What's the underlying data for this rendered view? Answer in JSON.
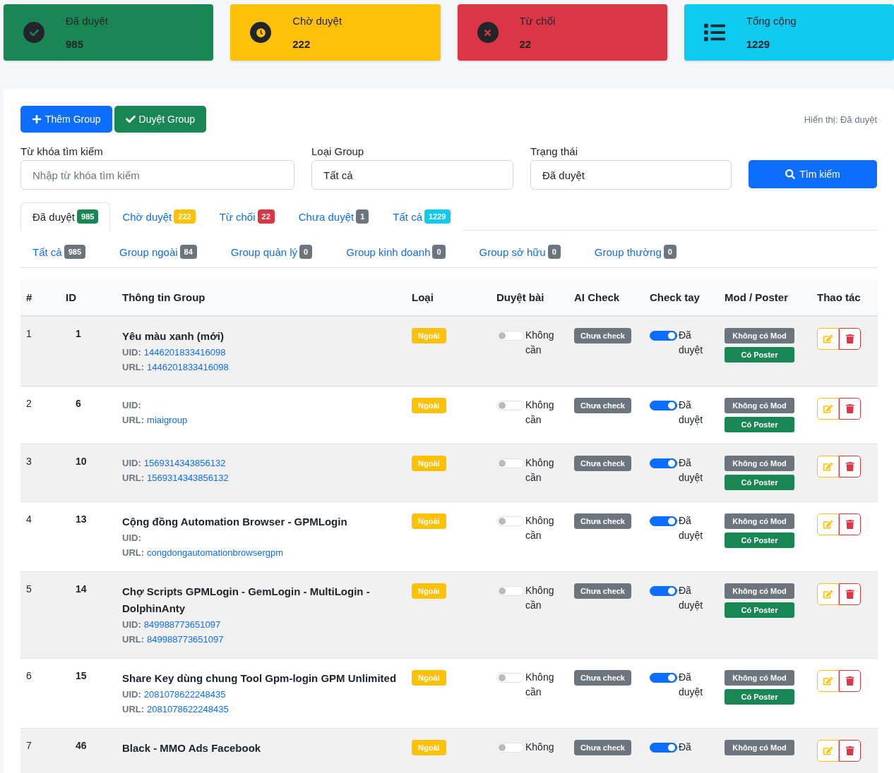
{
  "stats": [
    {
      "label": "Đã duyệt",
      "value": "985",
      "kind": "approved"
    },
    {
      "label": "Chờ duyệt",
      "value": "222",
      "kind": "pending"
    },
    {
      "label": "Từ chối",
      "value": "22",
      "kind": "rejected"
    },
    {
      "label": "Tổng cộng",
      "value": "1229",
      "kind": "total"
    }
  ],
  "actions": [
    {
      "label": "Thêm Group",
      "kind": "add"
    },
    {
      "label": "Duyệt Group",
      "kind": "approve"
    }
  ],
  "display_note": "Hiển thị: Đã duyệt",
  "filters": {
    "keyword": {
      "label": "Từ khóa tìm kiếm",
      "placeholder": "Nhập từ khóa tìm kiếm"
    },
    "type": {
      "label": "Loại Group",
      "value": "Tất cả"
    },
    "status": {
      "label": "Trạng thái",
      "value": "Đã duyệt"
    },
    "search_button": "Tìm kiếm"
  },
  "status_tabs": [
    {
      "label": "Đã duyệt",
      "count": "985",
      "color": "#198754",
      "selected": true
    },
    {
      "label": "Chờ duyệt",
      "count": "222",
      "color": "#ffc107",
      "selected": false
    },
    {
      "label": "Từ chối",
      "count": "22",
      "color": "#dc3545",
      "selected": false
    },
    {
      "label": "Chưa duyệt",
      "count": "1",
      "color": "#6c757d",
      "selected": false
    },
    {
      "label": "Tất cả",
      "count": "1229",
      "color": "#0dcaf0",
      "selected": false
    }
  ],
  "type_tabs": [
    {
      "label": "Tất cả",
      "count": "985"
    },
    {
      "label": "Group ngoài",
      "count": "84"
    },
    {
      "label": "Group quản lý",
      "count": "0"
    },
    {
      "label": "Group kinh doanh",
      "count": "0"
    },
    {
      "label": "Group sở hữu",
      "count": "0"
    },
    {
      "label": "Group thường",
      "count": "0"
    }
  ],
  "table": {
    "columns": [
      "#",
      "ID",
      "Thông tin Group",
      "Loại",
      "Duyệt bài",
      "AI Check",
      "Check tay",
      "Mod / Poster",
      "Thao tác"
    ],
    "rows": [
      {
        "index": "1",
        "id": "1",
        "name": "Yêu màu xanh (mới)",
        "uid_label": "UID:",
        "uid": "1446201833416098",
        "url_label": "URL:",
        "url": "1446201833416098",
        "type": "Ngoài",
        "post_review": {
          "on": false,
          "label": "Không cần"
        },
        "ai_check": "Chưa check",
        "manual_check": {
          "on": true,
          "label": "Đã duyệt"
        },
        "mod": "Không có Mod",
        "poster": "Có Poster"
      },
      {
        "index": "2",
        "id": "6",
        "uid_label": "UID:",
        "url_label": "URL:",
        "url": "miaigroup",
        "type": "Ngoài",
        "post_review": {
          "on": false,
          "label": "Không cần"
        },
        "ai_check": "Chưa check",
        "manual_check": {
          "on": true,
          "label": "Đã duyệt"
        },
        "mod": "Không có Mod",
        "poster": "Có Poster"
      },
      {
        "index": "3",
        "id": "10",
        "uid_label": "UID:",
        "uid": "1569314343856132",
        "url_label": "URL:",
        "url": "1569314343856132",
        "type": "Ngoài",
        "post_review": {
          "on": false,
          "label": "Không cần"
        },
        "ai_check": "Chưa check",
        "manual_check": {
          "on": true,
          "label": "Đã duyệt"
        },
        "mod": "Không có Mod",
        "poster": "Có Poster"
      },
      {
        "index": "4",
        "id": "13",
        "name": "Cộng đồng Automation Browser - GPMLogin",
        "uid_label": "UID:",
        "url_label": "URL:",
        "url": "congdongautomationbrowsergpm",
        "type": "Ngoài",
        "post_review": {
          "on": false,
          "label": "Không cần"
        },
        "ai_check": "Chưa check",
        "manual_check": {
          "on": true,
          "label": "Đã duyệt"
        },
        "mod": "Không có Mod",
        "poster": "Có Poster"
      },
      {
        "index": "5",
        "id": "14",
        "name": "Chợ Scripts GPMLogin - GemLogin - MultiLogin - DolphinAnty",
        "uid_label": "UID:",
        "uid": "849988773651097",
        "url_label": "URL:",
        "url": "849988773651097",
        "type": "Ngoài",
        "post_review": {
          "on": false,
          "label": "Không cần"
        },
        "ai_check": "Chưa check",
        "manual_check": {
          "on": true,
          "label": "Đã duyệt"
        },
        "mod": "Không có Mod",
        "poster": "Có Poster"
      },
      {
        "index": "6",
        "id": "15",
        "name": "Share Key dùng chung Tool Gpm-login GPM Unlimited",
        "uid_label": "UID:",
        "uid": "2081078622248435",
        "url_label": "URL:",
        "url": "2081078622248435",
        "type": "Ngoài",
        "post_review": {
          "on": false,
          "label": "Không cần"
        },
        "ai_check": "Chưa check",
        "manual_check": {
          "on": true,
          "label": "Đã duyệt"
        },
        "mod": "Không có Mod",
        "poster": "Có Poster"
      },
      {
        "index": "7",
        "id": "46",
        "name": "Black - MMO Ads Facebook",
        "type": "Ngoài",
        "post_review": {
          "on": false,
          "label": "Không"
        },
        "ai_check": "Chưa check",
        "manual_check": {
          "on": true,
          "label": "Đã"
        },
        "mod": "Không có Mod"
      }
    ]
  }
}
